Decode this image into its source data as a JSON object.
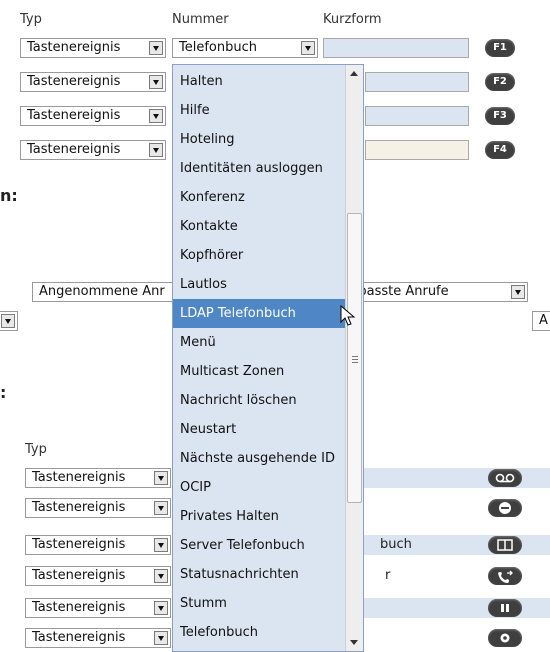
{
  "headers": {
    "typ": "Typ",
    "nummer": "Nummer",
    "kurzform": "Kurzform",
    "typ2": "Typ"
  },
  "section_labels": {
    "first": "n:",
    "second": ":"
  },
  "top_rows": [
    {
      "type": "Tastenereignis",
      "number": "Telefonbuch",
      "key": "F1"
    },
    {
      "type": "Tastenereignis",
      "key": "F2"
    },
    {
      "type": "Tastenereignis",
      "key": "F3"
    },
    {
      "type": "Tastenereignis",
      "key": "F4"
    }
  ],
  "call_filters": {
    "left": "Angenommene Anr",
    "right": "rpasste Anrufe",
    "edge": "A"
  },
  "bottom_rows": [
    {
      "type": "Tastenereignis",
      "tail": "",
      "icon": "voicemail-icon"
    },
    {
      "type": "Tastenereignis",
      "tail": "",
      "icon": "do-not-disturb-icon"
    },
    {
      "type": "Tastenereignis",
      "tail": "buch",
      "icon": "phonebook-icon"
    },
    {
      "type": "Tastenereignis",
      "tail": "r",
      "icon": "call-forward-icon"
    },
    {
      "type": "Tastenereignis",
      "tail": "",
      "icon": "pause-icon"
    },
    {
      "type": "Tastenereignis",
      "tail": "",
      "icon": "settings-icon"
    }
  ],
  "dropdown": {
    "items": [
      "Halten",
      "Hilfe",
      "Hoteling",
      "Identitäten ausloggen",
      "Konferenz",
      "Kontakte",
      "Kopfhörer",
      "Lautlos",
      "LDAP Telefonbuch",
      "Menü",
      "Multicast Zonen",
      "Nachricht löschen",
      "Neustart",
      "Nächste ausgehende ID",
      "OCIP",
      "Privates Halten",
      "Server Telefonbuch",
      "Statusnachrichten",
      "Stumm",
      "Telefonbuch"
    ],
    "highlighted": "LDAP Telefonbuch",
    "scroll_position": 0.5
  }
}
